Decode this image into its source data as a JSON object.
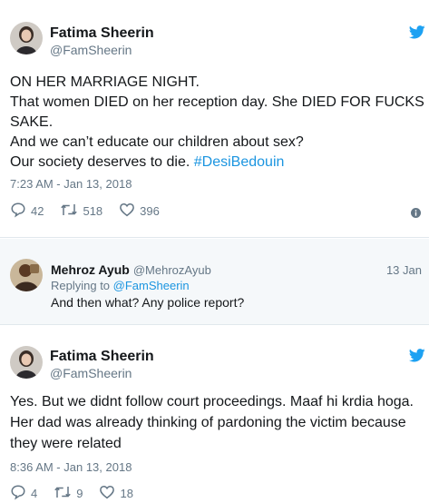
{
  "tweet1": {
    "name": "Fatima Sheerin",
    "handle": "@FamSheerin",
    "lines": [
      "ON HER MARRIAGE NIGHT.",
      "That women DIED on her reception day. She DIED FOR FUCKS",
      "SAKE.",
      "And we can’t educate our children about sex?"
    ],
    "last_line_text": "Our society deserves to die. ",
    "hashtag": "#DesiBedouin",
    "timestamp": "7:23 AM - Jan 13, 2018",
    "replies": "42",
    "retweets": "518",
    "likes": "396"
  },
  "reply": {
    "name": "Mehroz Ayub",
    "handle": "@MehrozAyub",
    "date": "13 Jan",
    "replying_prefix": "Replying to ",
    "replying_to": "@FamSheerin",
    "text": "And then what? Any police report?"
  },
  "tweet2": {
    "name": "Fatima Sheerin",
    "handle": "@FamSheerin",
    "lines": [
      "Yes. But we didnt follow court proceedings. Maaf hi krdia hoga.",
      "Her dad was already thinking of pardoning the victim because",
      "they were related"
    ],
    "timestamp": "8:36 AM - Jan 13, 2018",
    "replies": "4",
    "retweets": "9",
    "likes": "18"
  },
  "icons": {
    "bird": "twitter-bird-icon",
    "reply": "reply-icon",
    "retweet": "retweet-icon",
    "like": "heart-icon",
    "info": "info-icon"
  },
  "colors": {
    "brand": "#1da1f2",
    "link": "#1b95e0",
    "muted": "#657786",
    "text": "#14171a",
    "reply_bg": "#f5f8fa"
  }
}
